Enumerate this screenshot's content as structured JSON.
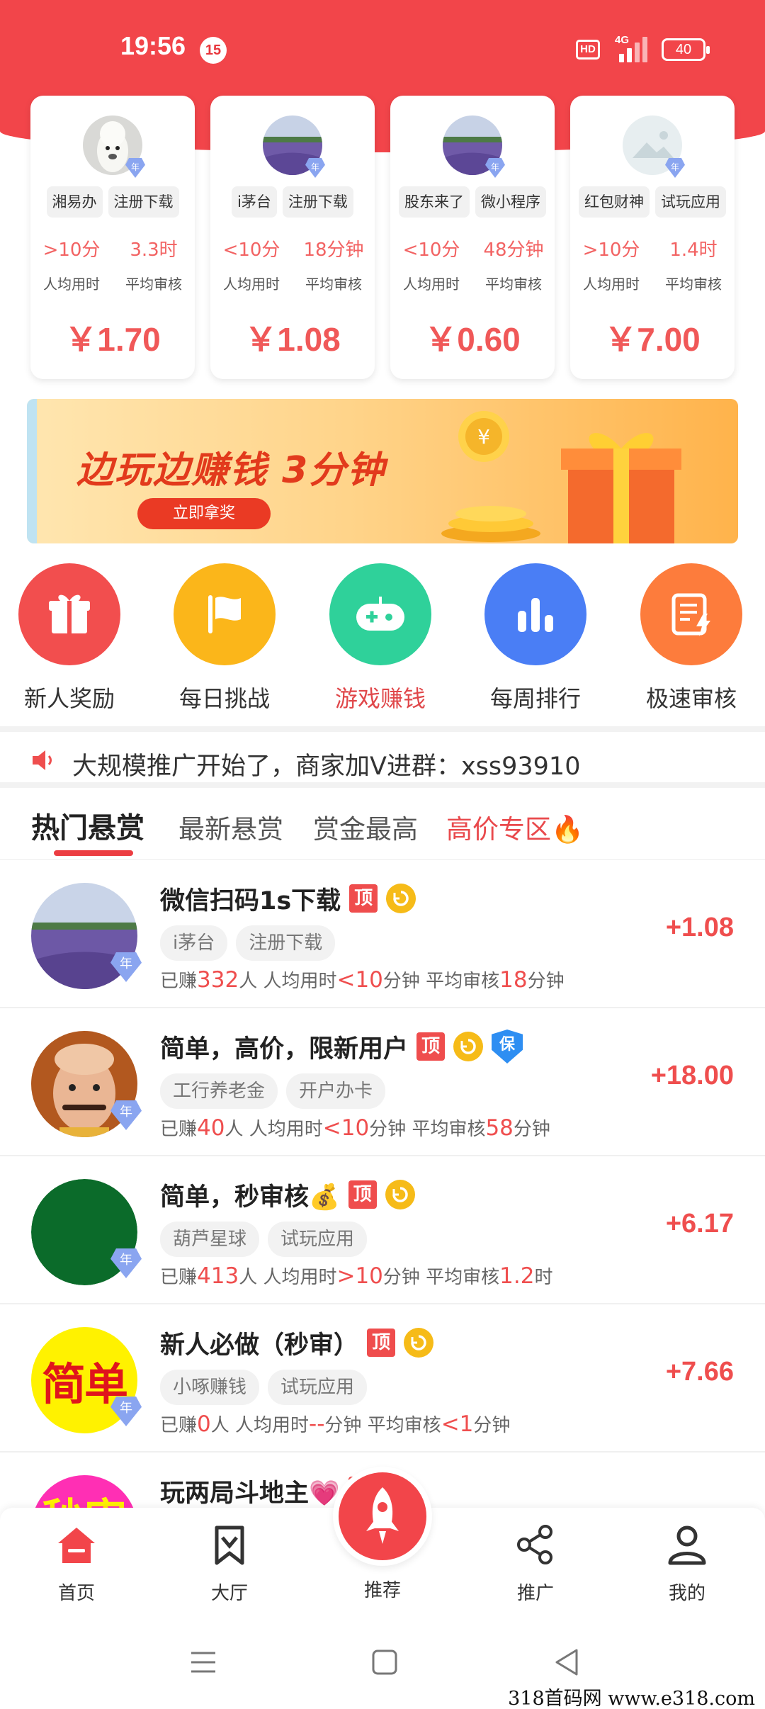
{
  "status_bar": {
    "time": "19:56",
    "notif_count": "15",
    "hd": "HD",
    "network": "4G",
    "battery": "40"
  },
  "task_cards": [
    {
      "tags": [
        "湘易办",
        "注册下载"
      ],
      "time_val": ">10分",
      "review_val": "3.3时",
      "time_label": "人均用时",
      "review_label": "平均审核",
      "price": "￥1.70",
      "badge": "年"
    },
    {
      "tags": [
        "i茅台",
        "注册下载"
      ],
      "time_val": "<10分",
      "review_val": "18分钟",
      "time_label": "人均用时",
      "review_label": "平均审核",
      "price": "￥1.08",
      "badge": "年"
    },
    {
      "tags": [
        "股东来了",
        "微小程序"
      ],
      "time_val": "<10分",
      "review_val": "48分钟",
      "time_label": "人均用时",
      "review_label": "平均审核",
      "price": "￥0.60",
      "badge": "年"
    },
    {
      "tags": [
        "红包财神",
        "试玩应用"
      ],
      "time_val": ">10分",
      "review_val": "1.4时",
      "time_label": "人均用时",
      "review_label": "平均审核",
      "price": "￥7.00",
      "badge": "年"
    }
  ],
  "banner": {
    "title": "边玩边赚钱 3分钟",
    "button": "立即拿奖"
  },
  "quick_actions": [
    {
      "label": "新人奖励",
      "color": "#f24e4e",
      "icon": "gift-icon"
    },
    {
      "label": "每日挑战",
      "color": "#fbb61a",
      "icon": "flag-icon"
    },
    {
      "label": "游戏赚钱",
      "color": "#2fd19a",
      "icon": "gamepad-icon"
    },
    {
      "label": "每周排行",
      "color": "#4a7ef5",
      "icon": "bar-chart-icon"
    },
    {
      "label": "极速审核",
      "color": "#fd7c3c",
      "icon": "fast-review-icon"
    }
  ],
  "notice": {
    "text": "大规模推广开始了，商家加V进群：xss93910"
  },
  "tabs": [
    "热门悬赏",
    "最新悬赏",
    "赏金最高",
    "高价专区🔥"
  ],
  "tasks": [
    {
      "title": "微信扫码1s下载",
      "top": "顶",
      "shield": "",
      "tags": [
        "i茅台",
        "注册下载"
      ],
      "earned": "332",
      "time": "<10",
      "time_unit": "分钟",
      "review": "18",
      "review_unit": "分钟",
      "reward": "+1.08",
      "badge": "年"
    },
    {
      "title": "简单，高价，限新用户",
      "top": "顶",
      "shield": "保",
      "tags": [
        "工行养老金",
        "开户办卡"
      ],
      "earned": "40",
      "time": "<10",
      "time_unit": "分钟",
      "review": "58",
      "review_unit": "分钟",
      "reward": "+18.00",
      "badge": "年"
    },
    {
      "title": "简单，秒审核💰",
      "top": "顶",
      "shield": "",
      "tags": [
        "葫芦星球",
        "试玩应用"
      ],
      "earned": "413",
      "time": ">10",
      "time_unit": "分钟",
      "review": "1.2",
      "review_unit": "时",
      "reward": "+6.17",
      "badge": "年"
    },
    {
      "title": "新人必做（秒审）",
      "top": "顶",
      "shield": "",
      "tags": [
        "小啄赚钱",
        "试玩应用"
      ],
      "earned": "0",
      "time": "--",
      "time_unit": "分钟",
      "review": "<1",
      "review_unit": "分钟",
      "reward": "+7.66",
      "badge": "年",
      "avatar_text": "简单"
    },
    {
      "title": "玩两局斗地主💗",
      "top": "顶",
      "shield": "",
      "avatar_text": "秒审"
    }
  ],
  "stat_labels": {
    "earned_prefix": "已赚",
    "earned_suffix": "人",
    "time_prefix": " 人均用时",
    "review_prefix": " 平均审核"
  },
  "bottom_nav": [
    {
      "label": "首页",
      "icon": "home-icon",
      "active": true
    },
    {
      "label": "大厅",
      "icon": "bookmark-icon"
    },
    {
      "label": "推荐",
      "icon": "rocket-icon"
    },
    {
      "label": "推广",
      "icon": "share-icon"
    },
    {
      "label": "我的",
      "icon": "profile-icon"
    }
  ],
  "watermark": "318首码网  www.e318.com",
  "colors": {
    "brand_red": "#f2454a",
    "accent_text": "#ef4e4e",
    "badge_blue": "#8aa5f0"
  }
}
